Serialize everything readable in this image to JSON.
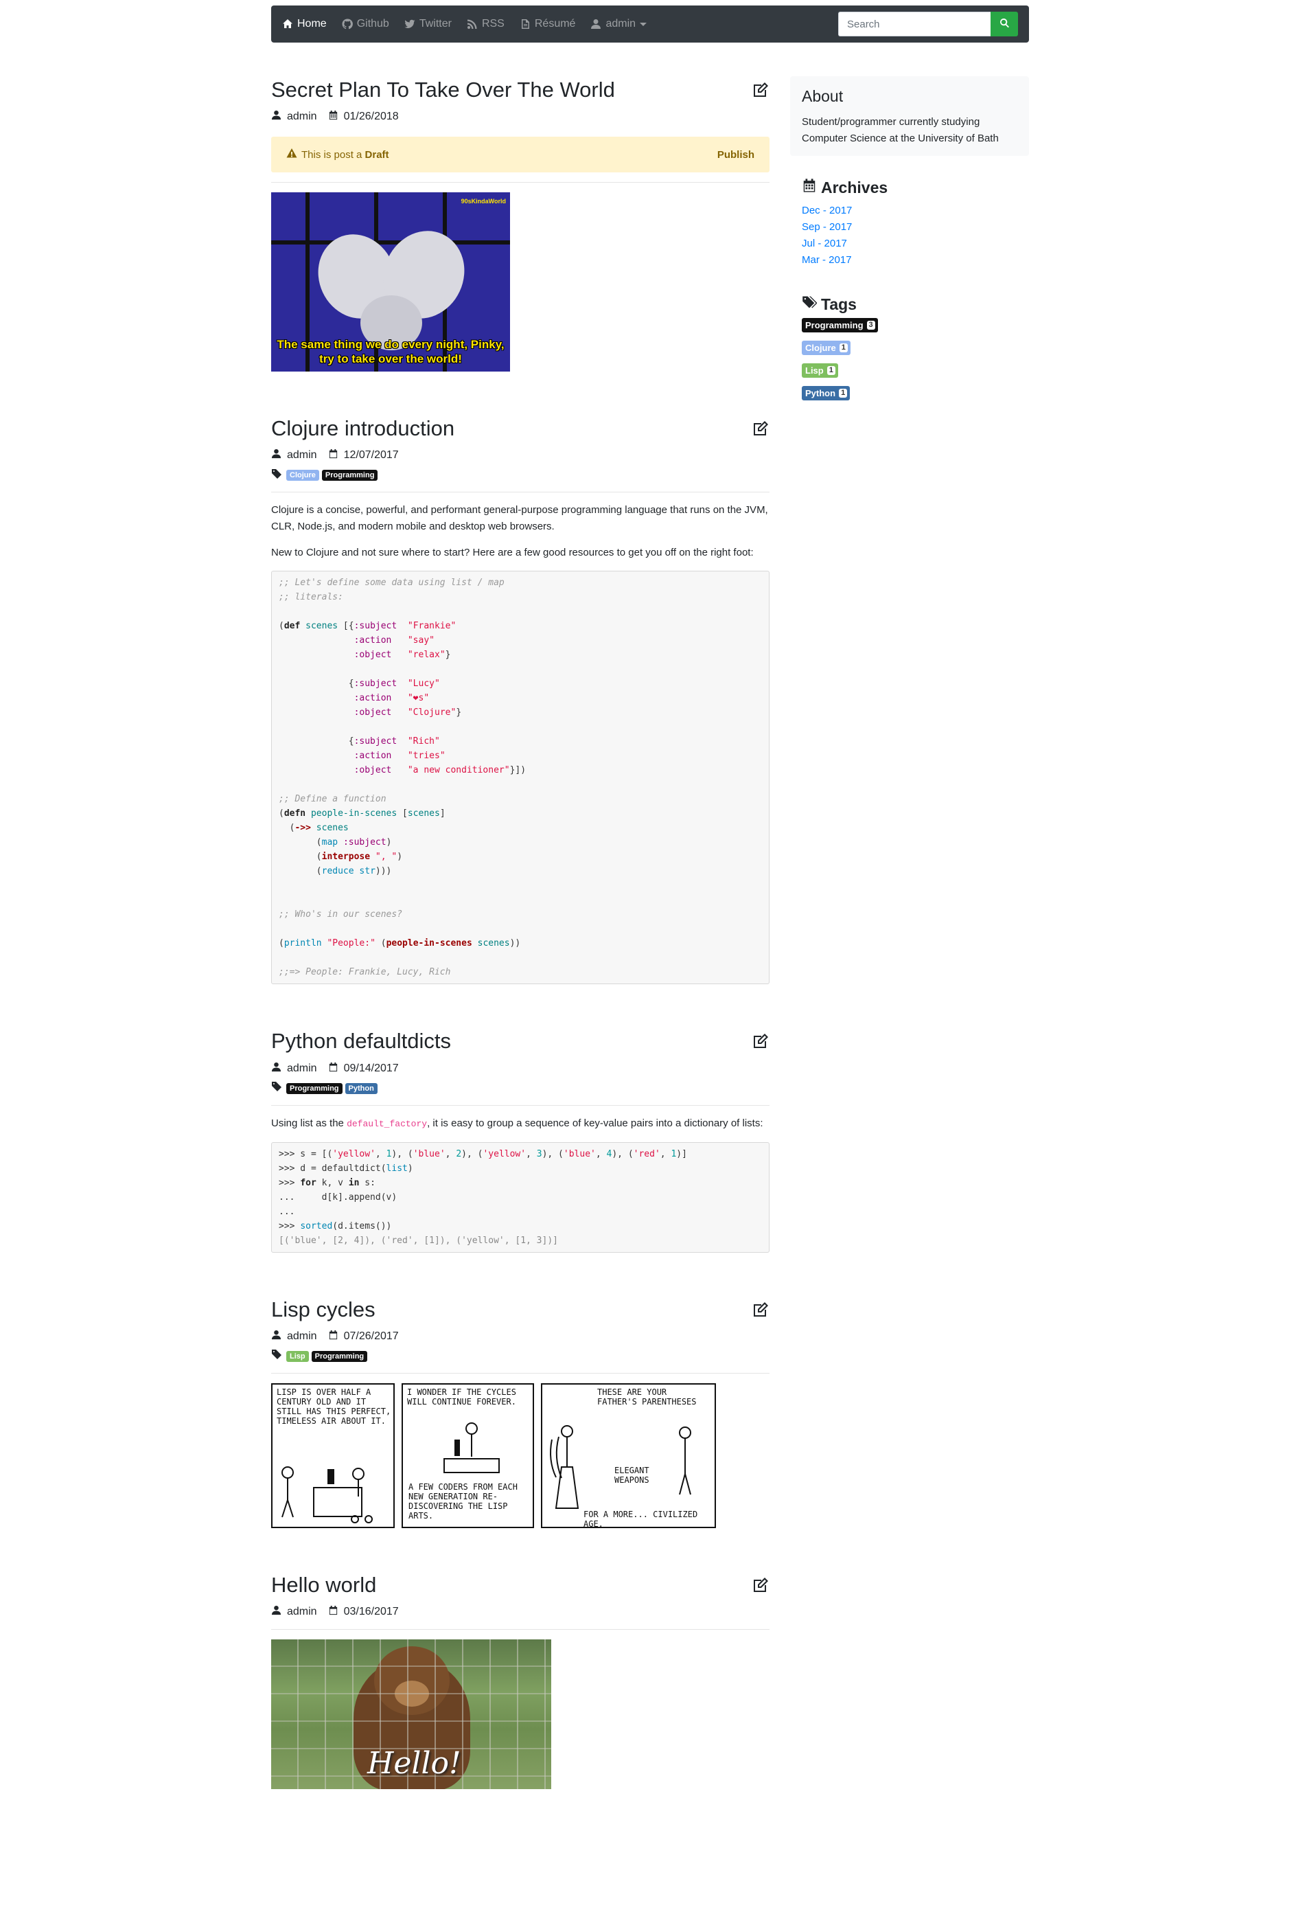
{
  "nav": {
    "home": "Home",
    "github": "Github",
    "twitter": "Twitter",
    "rss": "RSS",
    "resume": "Résumé",
    "admin": "admin",
    "search_placeholder": "Search"
  },
  "posts": {
    "p1": {
      "title": "Secret Plan To Take Over The World",
      "author": "admin",
      "date": "01/26/2018",
      "draft_prefix": "This is post a",
      "draft_word": "Draft",
      "publish": "Publish",
      "image_caption_1": "The same thing we do every night, Pinky,",
      "image_caption_2": "try to take over the world!",
      "image_watermark": "90sKindaWorld"
    },
    "p2": {
      "title": "Clojure introduction",
      "author": "admin",
      "date": "12/07/2017",
      "tags": [
        "Clojure",
        "Programming"
      ],
      "para1": "Clojure is a concise, powerful, and performant general-purpose programming language that runs on the JVM, CLR, Node.js, and modern mobile and desktop web browsers.",
      "para2": "New to Clojure and not sure where to start? Here are a few good resources to get you off on the right foot:"
    },
    "p3": {
      "title": "Python defaultdicts",
      "author": "admin",
      "date": "09/14/2017",
      "tags": [
        "Programming",
        "Python"
      ],
      "para_pre": "Using list as the",
      "para_code": "default_factory",
      "para_post": ", it is easy to group a sequence of key-value pairs into a dictionary of lists:"
    },
    "p4": {
      "title": "Lisp cycles",
      "author": "admin",
      "date": "07/26/2017",
      "tags": [
        "Lisp",
        "Programming"
      ],
      "comic1": "Lisp is over half a century old and it still has this perfect, timeless air about it.",
      "comic2a": "I wonder if the cycles will continue forever.",
      "comic2b": "A few coders from each new generation re-discovering the Lisp arts.",
      "comic3a": "These are your father's parentheses",
      "comic3b": "Elegant weapons",
      "comic3c": "for a more... civilized age."
    },
    "p5": {
      "title": "Hello world",
      "author": "admin",
      "date": "03/16/2017",
      "image_text": "Hello!"
    }
  },
  "sidebar": {
    "about_title": "About",
    "about_text": "Student/programmer currently studying Computer Science at the University of Bath",
    "archives_title": "Archives",
    "archives": [
      "Dec - 2017",
      "Sep - 2017",
      "Jul - 2017",
      "Mar - 2017"
    ],
    "tags_title": "Tags",
    "tags": [
      {
        "name": "Programming",
        "count": "3",
        "color": "#111111"
      },
      {
        "name": "Clojure",
        "count": "1",
        "color": "#91b4f0"
      },
      {
        "name": "Lisp",
        "count": "1",
        "color": "#7fbf5f"
      },
      {
        "name": "Python",
        "count": "1",
        "color": "#3a6ea5"
      }
    ]
  },
  "colors": {
    "navbar": "#343a40",
    "search_button": "#28a745",
    "link": "#007bff",
    "draft_bg": "#fff3cd"
  },
  "icons": [
    "home-icon",
    "github-icon",
    "twitter-icon",
    "rss-icon",
    "file-icon",
    "user-icon",
    "search-icon",
    "edit-icon",
    "calendar-icon",
    "tag-icon",
    "warning-icon",
    "tags-icon"
  ]
}
